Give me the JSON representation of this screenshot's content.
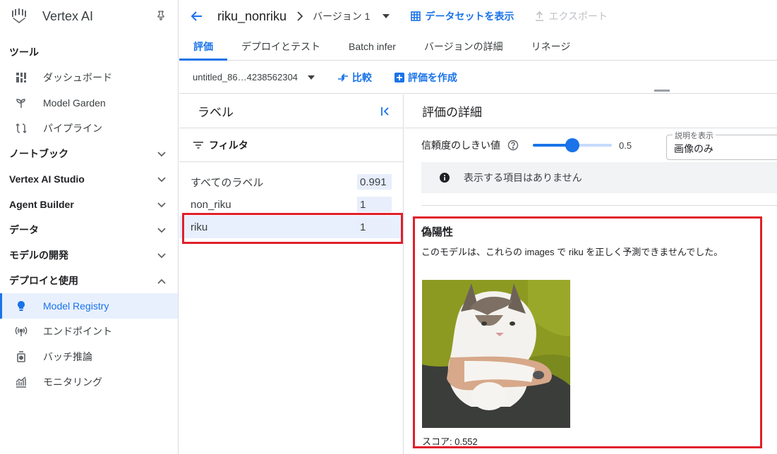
{
  "app": {
    "title": "Vertex AI"
  },
  "sidebar": {
    "tools_label": "ツール",
    "tools": [
      {
        "label": "ダッシュボード",
        "icon": "dashboard-icon"
      },
      {
        "label": "Model Garden",
        "icon": "sprout-icon"
      },
      {
        "label": "パイプライン",
        "icon": "pipeline-icon"
      }
    ],
    "sections": [
      {
        "label": "ノートブック",
        "expanded": false
      },
      {
        "label": "Vertex AI Studio",
        "expanded": false
      },
      {
        "label": "Agent Builder",
        "expanded": false
      },
      {
        "label": "データ",
        "expanded": false
      },
      {
        "label": "モデルの開発",
        "expanded": false
      },
      {
        "label": "デプロイと使用",
        "expanded": true
      }
    ],
    "deploy_items": [
      {
        "label": "Model Registry",
        "icon": "lightbulb-icon",
        "active": true
      },
      {
        "label": "エンドポイント",
        "icon": "broadcast-icon"
      },
      {
        "label": "バッチ推論",
        "icon": "batch-icon"
      },
      {
        "label": "モニタリング",
        "icon": "monitoring-icon"
      }
    ]
  },
  "header": {
    "model_name": "riku_nonriku",
    "version": "バージョン 1",
    "show_dataset": "データセットを表示",
    "export": "エクスポート"
  },
  "tabs": [
    "評価",
    "デプロイとテスト",
    "Batch infer",
    "バージョンの詳細",
    "リネージ"
  ],
  "toolbar": {
    "evaluation_select": "untitled_86…4238562304",
    "compare": "比較",
    "create_eval": "評価を作成"
  },
  "labels_panel": {
    "title": "ラベル",
    "filter": "フィルタ",
    "rows": [
      {
        "label": "すべてのラベル",
        "value": "0.991"
      },
      {
        "label": "non_riku",
        "value": "1"
      },
      {
        "label": "riku",
        "value": "1",
        "selected": true
      }
    ]
  },
  "details_panel": {
    "title": "評価の詳細",
    "threshold_label": "信頼度のしきい値",
    "threshold_value": "0.5",
    "threshold_fraction": 0.5,
    "display_legend": "説明を表示",
    "display_value": "画像のみ",
    "no_items": "表示する項目はありません",
    "fp_title": "偽陽性",
    "fp_desc": "このモデルは、これらの images で riku を正しく予測できませんでした。",
    "score": "スコア: 0.552"
  },
  "colors": {
    "accent": "#1a73e8",
    "highlight": "#e0202b"
  }
}
